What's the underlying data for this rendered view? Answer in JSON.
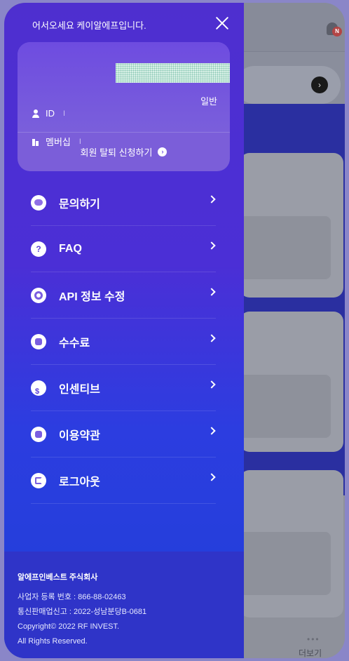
{
  "background": {
    "notification_badge": "N",
    "more_label": "더보기"
  },
  "drawer": {
    "greeting": "어서오세요 케이알에프입니다.",
    "account": {
      "id_label": "ID",
      "membership_label": "멤버십",
      "separator": "I",
      "membership_value": "일반",
      "withdraw_label": "회원 탈퇴 신청하기"
    },
    "menu": [
      {
        "label": "문의하기",
        "icon": "chat-icon"
      },
      {
        "label": "FAQ",
        "icon": "question-icon"
      },
      {
        "label": "API 정보 수정",
        "icon": "gear-icon"
      },
      {
        "label": "수수료",
        "icon": "fee-icon"
      },
      {
        "label": "인센티브",
        "icon": "incentive-icon"
      },
      {
        "label": "이용약관",
        "icon": "terms-icon"
      },
      {
        "label": "로그아웃",
        "icon": "logout-icon"
      }
    ],
    "footer": {
      "company": "알에프인베스트 주식회사",
      "business_number": "사업자 등록 번호 : 866-88-02463",
      "telecom_number": "통신판매업신고 : 2022-성남분당B-0681",
      "copyright": "Copyright© 2022 RF INVEST.",
      "rights": "All Rights Reserved."
    }
  },
  "colors": {
    "drawer_top": "#4e2fcf",
    "drawer_bottom": "#1f3fd8",
    "card": "#7b5ed9",
    "footer": "#2f34c8"
  }
}
